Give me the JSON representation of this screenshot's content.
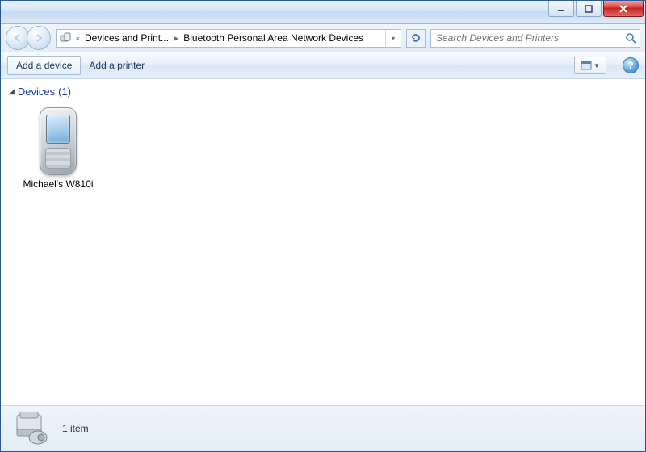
{
  "breadcrumb": {
    "segment1": "Devices and Print...",
    "segment2": "Bluetooth Personal Area Network Devices"
  },
  "search": {
    "placeholder": "Search Devices and Printers"
  },
  "toolbar": {
    "add_device": "Add a device",
    "add_printer": "Add a printer"
  },
  "group": {
    "title": "Devices",
    "count": "(1)"
  },
  "items": [
    {
      "label": "Michael's W810i"
    }
  ],
  "status": {
    "count_text": "1 item"
  }
}
